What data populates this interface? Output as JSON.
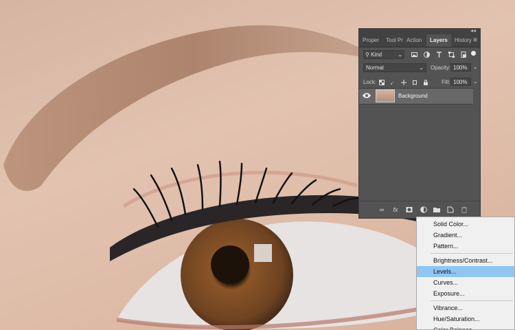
{
  "panel": {
    "tabs": [
      {
        "label": "Proper"
      },
      {
        "label": "Tool Pr"
      },
      {
        "label": "Action"
      },
      {
        "label": "Layers"
      },
      {
        "label": "History"
      }
    ],
    "active_tab": "Layers",
    "filter": {
      "label": "Kind",
      "search_icon": "search-icon"
    },
    "filter_icons": [
      "image-filter-icon",
      "adjustment-filter-icon",
      "type-filter-icon",
      "shape-filter-icon",
      "smart-object-filter-icon"
    ],
    "blend_mode": "Normal",
    "opacity": {
      "label": "Opacity:",
      "value": "100%"
    },
    "lock": {
      "label": "Lock:"
    },
    "fill": {
      "label": "Fill:",
      "value": "100%"
    },
    "layers": [
      {
        "name": "Background",
        "visible": true
      }
    ],
    "bottom_icons": [
      "link-icon",
      "fx-icon",
      "mask-icon",
      "adjustment-layer-icon",
      "group-folder-icon",
      "new-layer-icon",
      "trash-icon"
    ],
    "fx_label": "fx"
  },
  "menu": {
    "groups": [
      [
        "Solid Color...",
        "Gradient...",
        "Pattern..."
      ],
      [
        "Brightness/Contrast...",
        "Levels...",
        "Curves...",
        "Exposure..."
      ],
      [
        "Vibrance...",
        "Hue/Saturation...",
        "Color Balance..."
      ]
    ],
    "highlighted": "Levels..."
  },
  "colors": {
    "panel_bg": "#535353",
    "menu_highlight": "#8fc6f4",
    "skin": "#dcbca8"
  }
}
